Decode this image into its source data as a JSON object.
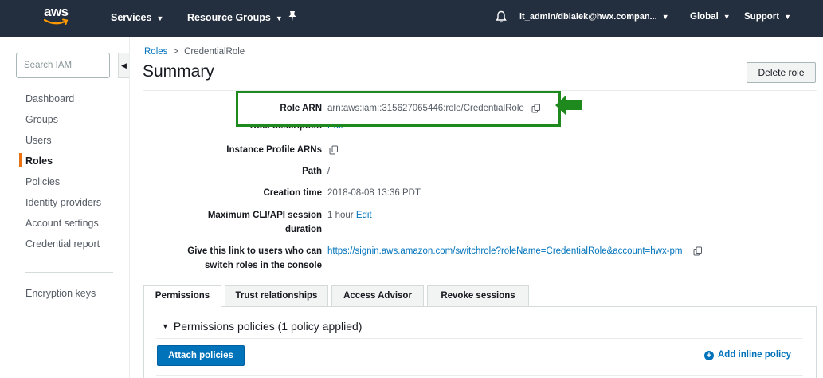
{
  "topbar": {
    "logo_text": "aws",
    "services": "Services",
    "resource_groups": "Resource Groups",
    "pin_icon": "pin-icon",
    "bell_icon": "bell-icon",
    "user": "it_admin/dbialek@hwx.compan...",
    "region": "Global",
    "support": "Support",
    "background_color": "#232f3e"
  },
  "sidebar": {
    "search_placeholder": "Search IAM",
    "collapse_icon": "chevron-left-icon",
    "items": [
      {
        "label": "Dashboard"
      },
      {
        "label": "Groups"
      },
      {
        "label": "Users"
      },
      {
        "label": "Roles",
        "active": true
      },
      {
        "label": "Policies"
      },
      {
        "label": "Identity providers"
      },
      {
        "label": "Account settings"
      },
      {
        "label": "Credential report"
      }
    ],
    "extra_items": [
      {
        "label": "Encryption keys"
      }
    ],
    "active_color": "#ec7211"
  },
  "breadcrumb": {
    "parent": "Roles",
    "separator": ">",
    "current": "CredentialRole"
  },
  "page": {
    "title": "Summary",
    "delete_button": "Delete role"
  },
  "summary": {
    "role_arn_label": "Role ARN",
    "role_arn_value": "arn:aws:iam::315627065446:role/CredentialRole",
    "role_description_label": "Role description",
    "role_description_edit": "Edit",
    "instance_profile_label": "Instance Profile ARNs",
    "path_label": "Path",
    "path_value": "/",
    "creation_time_label": "Creation time",
    "creation_time_value": "2018-08-08 13:36 PDT",
    "max_session_label_1": "Maximum CLI/API session",
    "max_session_label_2": "duration",
    "max_session_value": "1 hour",
    "max_session_edit": "Edit",
    "switch_link_label_1": "Give this link to users who can",
    "switch_link_label_2": "switch roles in the console",
    "switch_link_value": "https://signin.aws.amazon.com/switchrole?roleName=CredentialRole&account=hwx-pm",
    "highlight_color": "#1e8a1e"
  },
  "tabs": [
    {
      "label": "Permissions",
      "active": true
    },
    {
      "label": "Trust relationships"
    },
    {
      "label": "Access Advisor"
    },
    {
      "label": "Revoke sessions"
    }
  ],
  "permissions": {
    "section_title": "Permissions policies (1 policy applied)",
    "attach_button": "Attach policies",
    "add_inline": "Add inline policy",
    "accent_color": "#0073bb"
  }
}
